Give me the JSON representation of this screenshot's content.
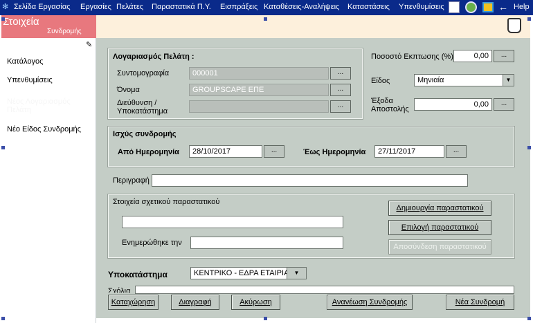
{
  "menubar": {
    "items": [
      "Σελίδα Εργασίας",
      "Εργασίες",
      "Πελάτες",
      "Παραστατικά Π.Υ.",
      "Εισπράξεις",
      "Καταθέσεις-Αναλήψεις",
      "Καταστάσεις",
      "Υπενθυμίσεις"
    ],
    "help_label": "Help"
  },
  "left": {
    "title": "Στοιχεία",
    "subtitle": "Συνδρομής",
    "items": [
      "Κατάλογος",
      "Υπενθυμίσεις",
      "Νέος Λογαριασμός Πελάτη",
      "Νέο Είδος Συνδρομής"
    ]
  },
  "customer": {
    "heading": "Λογαριασμός Πελάτη :",
    "abbr_label": "Συντομογραφία",
    "abbr_value": "000001",
    "name_label": "Όνομα",
    "name_value": "GROUPSCAPE ΕΠΕ",
    "addr_label_1": "Διεύθυνση /",
    "addr_label_2": "Υποκατάστημα",
    "addr_value": ""
  },
  "right": {
    "discount_label": "Ποσοστό Εκπτωσης (%)",
    "discount_value": "0,00",
    "type_label": "Είδος",
    "type_value": "Μηνιαία",
    "shipping_label_1": "Έξοδα",
    "shipping_label_2": "Αποστολής",
    "shipping_value": "0,00"
  },
  "validity": {
    "heading": "Ισχύς συνδρομής",
    "from_label": "Από Ημερομηνία",
    "from_value": "28/10/2017",
    "to_label": "Έως Ημερομηνία",
    "to_value": "27/11/2017"
  },
  "description": {
    "label": "Περιγραφή",
    "value": ""
  },
  "document": {
    "heading": "Στοιχεία σχετικού παραστατικού",
    "field_value": "",
    "updated_label": "Ενημερώθηκε την",
    "updated_value": "",
    "create_label": "Δημιουργία παραστατικού",
    "choose_label": "Επιλογή παραστατικού",
    "unlink_label": "Αποσύνδεση παραστατικού"
  },
  "branch": {
    "label": "Υποκατάστημα",
    "value": "ΚΕΝΤΡΙΚΟ - ΕΔΡΑ ΕΤΑΙΡΙΑΣ"
  },
  "comments_label": "Σχόλια",
  "dots_label": "...",
  "footer": {
    "save": "Καταχώρηση",
    "delete": "Διαγραφή",
    "cancel": "Ακύρωση",
    "renew": "Ανανέωση Συνδρομής",
    "new": "Νέα Συνδρομή"
  },
  "colors": {
    "menubar": "#0a2a8a",
    "left_header": "#e8787e",
    "form_bg": "#c4cdc6",
    "top_strip": "#fdf0dc"
  }
}
